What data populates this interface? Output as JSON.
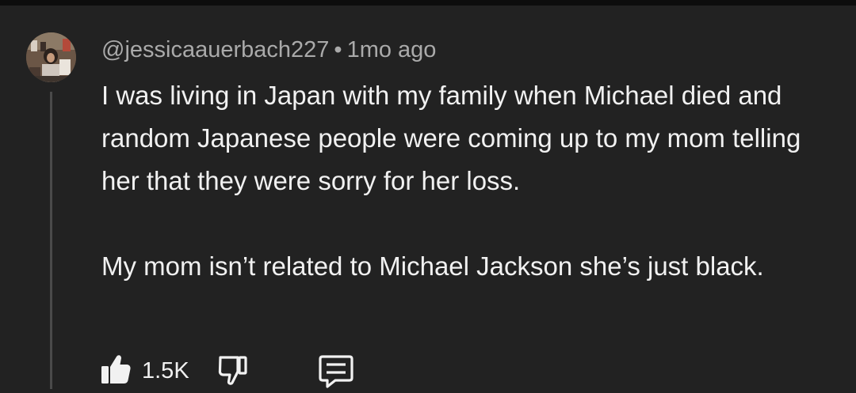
{
  "comment": {
    "author": "@jessicaauerbach227",
    "separator": "•",
    "time": "1mo ago",
    "paragraphs": [
      "I was living in Japan with my family when Michael died and random Japanese people were coming up to my mom telling her that they were sorry for her loss.",
      "My mom isn’t related to Michael Jackson she’s just black."
    ],
    "likes": "1.5K"
  },
  "icons": {
    "like": "thumbs-up-icon",
    "dislike": "thumbs-down-icon",
    "reply": "reply-comment-icon"
  },
  "colors": {
    "background": "#222222",
    "text": "#f1f1f1",
    "meta_text": "#aaaaaa",
    "thread_line": "#4a4a4a"
  }
}
